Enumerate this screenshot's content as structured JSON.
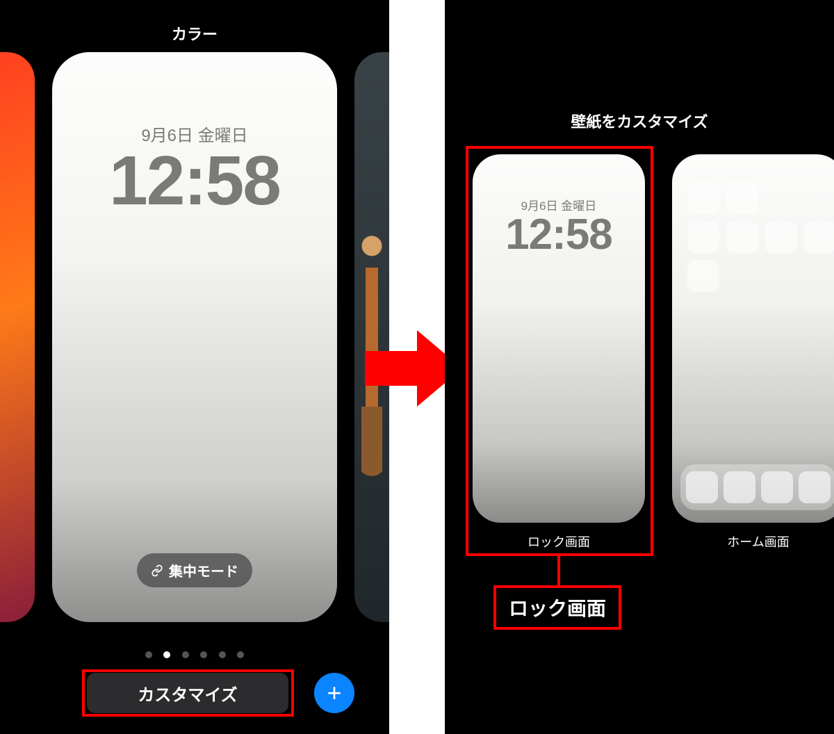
{
  "left": {
    "title": "カラー",
    "preview": {
      "date": "9月6日 金曜日",
      "time": "12:58"
    },
    "focus_label": "集中モード",
    "customize_label": "カスタマイズ",
    "page_dots": {
      "count": 6,
      "active_index": 1
    }
  },
  "right": {
    "title": "壁紙をカスタマイズ",
    "lock_preview": {
      "date": "9月6日 金曜日",
      "time": "12:58"
    },
    "lock_label": "ロック画面",
    "home_label": "ホーム画面",
    "callout_label": "ロック画面"
  },
  "colors": {
    "highlight": "#ff0000",
    "add_button": "#0a84ff"
  }
}
